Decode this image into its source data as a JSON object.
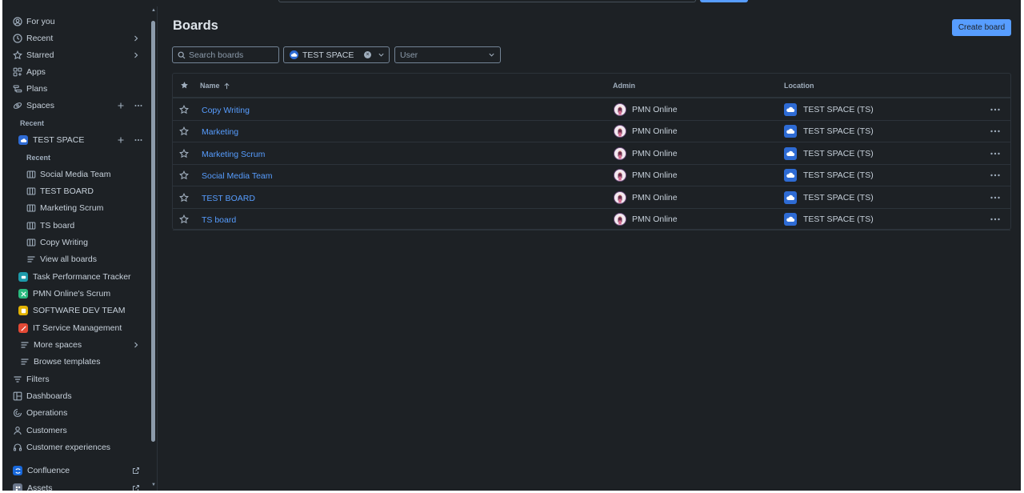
{
  "sidebar": {
    "nav": [
      {
        "label": "For you",
        "icon": "user-circle-icon"
      },
      {
        "label": "Recent",
        "icon": "clock-icon"
      },
      {
        "label": "Starred",
        "icon": "star-icon"
      },
      {
        "label": "Apps",
        "icon": "apps-icon"
      },
      {
        "label": "Plans",
        "icon": "plans-icon"
      },
      {
        "label": "Spaces",
        "icon": "spaces-icon"
      }
    ],
    "recent_label": "Recent",
    "space_name": "TEST SPACE",
    "space_recent_label": "Recent",
    "space_boards": [
      "Social Media Team",
      "TEST BOARD",
      "Marketing Scrum",
      "TS board",
      "Copy Writing"
    ],
    "view_all_boards": "View all boards",
    "other_spaces": [
      {
        "label": "Task Performance Tracker",
        "color": "#1d9aaa"
      },
      {
        "label": "PMN Online's Scrum",
        "color": "#2abb7f"
      },
      {
        "label": "SOFTWARE DEV TEAM",
        "color": "#e2b203"
      },
      {
        "label": "IT Service Management",
        "color": "#e34935"
      }
    ],
    "more_spaces": "More spaces",
    "browse_templates": "Browse templates",
    "bottom_nav": [
      {
        "label": "Filters",
        "icon": "filter-icon"
      },
      {
        "label": "Dashboards",
        "icon": "dashboard-icon"
      },
      {
        "label": "Operations",
        "icon": "operations-icon"
      },
      {
        "label": "Customers",
        "icon": "person-icon"
      },
      {
        "label": "Customer experiences",
        "icon": "headset-icon"
      }
    ],
    "apps": [
      {
        "label": "Confluence",
        "icon": "confluence-icon"
      },
      {
        "label": "Assets",
        "icon": "assets-icon"
      }
    ]
  },
  "main": {
    "title": "Boards",
    "create_button": "Create board",
    "search_placeholder": "Search boards",
    "space_filter": "TEST SPACE",
    "user_placeholder": "User",
    "columns": {
      "name": "Name",
      "admin": "Admin",
      "location": "Location"
    },
    "rows": [
      {
        "name": "Copy Writing",
        "admin": "PMN Online",
        "location": "TEST SPACE (TS)"
      },
      {
        "name": "Marketing",
        "admin": "PMN Online",
        "location": "TEST SPACE (TS)"
      },
      {
        "name": "Marketing Scrum",
        "admin": "PMN Online",
        "location": "TEST SPACE (TS)"
      },
      {
        "name": "Social Media Team",
        "admin": "PMN Online",
        "location": "TEST SPACE (TS)"
      },
      {
        "name": "TEST BOARD",
        "admin": "PMN Online",
        "location": "TEST SPACE (TS)"
      },
      {
        "name": "TS board",
        "admin": "PMN Online",
        "location": "TEST SPACE (TS)"
      }
    ]
  },
  "colors": {
    "background": "#1d2125",
    "accent": "#579dff",
    "text": "#c7d1db",
    "muted": "#9fadbc"
  }
}
